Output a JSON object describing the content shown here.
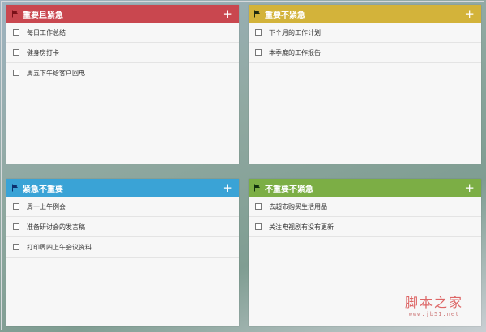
{
  "quadrants": [
    {
      "title": "重要且紧急",
      "add_label": "+",
      "header_color": "#c9474f",
      "flag_color": "#7a1118",
      "items": [
        "每日工作总结",
        "健身房打卡",
        "周五下午给客户回电"
      ]
    },
    {
      "title": "重要不紧急",
      "add_label": "+",
      "header_color": "#d3b33a",
      "flag_color": "#1f2a10",
      "items": [
        "下个月的工作计划",
        "本季度的工作报告"
      ]
    },
    {
      "title": "紧急不重要",
      "add_label": "+",
      "header_color": "#3aa3d6",
      "flag_color": "#0c2f6e",
      "items": [
        "周一上午例会",
        "准备研讨会的发言稿",
        "打印周四上午会议资料"
      ]
    },
    {
      "title": "不重要不紧急",
      "add_label": "+",
      "header_color": "#7cae45",
      "flag_color": "#12300e",
      "items": [
        "去超市购买生活用品",
        "关注电视剧有没有更新"
      ]
    }
  ],
  "watermark": {
    "main": "脚本之家",
    "sub": "www.jb51.net"
  }
}
